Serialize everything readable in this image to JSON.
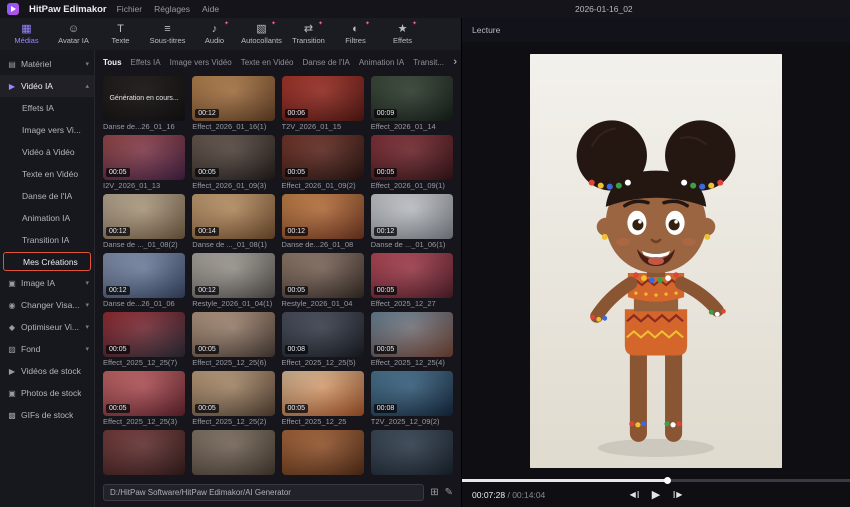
{
  "colors": {
    "accent": "#9a86ff",
    "selection_border": "#e0523a",
    "badge": "#ff5a8a",
    "progress_played": "#e8e8ec"
  },
  "menubar": {
    "app_name": "HitPaw Edimakor",
    "menus": [
      {
        "label": "Fichier"
      },
      {
        "label": "Réglages"
      },
      {
        "label": "Aide"
      }
    ],
    "document_title": "2026-01-16_02"
  },
  "toolbar": {
    "items": [
      {
        "label": "Médias",
        "icon": "▦",
        "icon_name": "media-icon",
        "active": true
      },
      {
        "label": "Avatar IA",
        "icon": "☺",
        "icon_name": "ai-avatar-icon"
      },
      {
        "label": "Texte",
        "icon": "T",
        "icon_name": "text-icon"
      },
      {
        "label": "Sous-titres",
        "icon": "≡",
        "icon_name": "subtitles-icon"
      },
      {
        "label": "Audio",
        "icon": "♪",
        "icon_name": "audio-icon",
        "badge": "✦"
      },
      {
        "label": "Autocollants",
        "icon": "▧",
        "icon_name": "stickers-icon",
        "badge": "✦"
      },
      {
        "label": "Transition",
        "icon": "⇄",
        "icon_name": "transition-icon",
        "badge": "✦"
      },
      {
        "label": "Filtres",
        "icon": "◐",
        "icon_name": "filters-icon",
        "badge": "✦"
      },
      {
        "label": "Effets",
        "icon": "★",
        "icon_name": "effects-icon",
        "badge": "✦"
      }
    ]
  },
  "sidebar": {
    "items": [
      {
        "label": "Matériel",
        "icon": "▤",
        "icon_name": "material-icon",
        "chevron": "▾"
      },
      {
        "label": "Vidéo IA",
        "icon": "▶",
        "icon_name": "ai-video-icon",
        "chevron": "▴",
        "active": true
      },
      {
        "label": "Effets IA",
        "sub": true
      },
      {
        "label": "Image vers Vi...",
        "sub": true
      },
      {
        "label": "Vidéo à Vidéo",
        "sub": true
      },
      {
        "label": "Texte en Vidéo",
        "sub": true
      },
      {
        "label": "Danse de l'IA",
        "sub": true
      },
      {
        "label": "Animation IA",
        "sub": true
      },
      {
        "label": "Transition IA",
        "sub": true
      },
      {
        "label": "Mes Créations",
        "sub": true,
        "selected": true
      },
      {
        "label": "Image IA",
        "icon": "▣",
        "icon_name": "ai-image-icon",
        "chevron": "▾"
      },
      {
        "label": "Changer Visa...",
        "icon": "◉",
        "icon_name": "face-swap-icon",
        "chevron": "▾"
      },
      {
        "label": "Optimiseur Vi...",
        "icon": "◆",
        "icon_name": "video-enhancer-icon",
        "chevron": "▾"
      },
      {
        "label": "Fond",
        "icon": "▨",
        "icon_name": "background-icon",
        "chevron": "▾"
      },
      {
        "label": "Vidéos de stock",
        "icon": "▶",
        "icon_name": "stock-videos-icon"
      },
      {
        "label": "Photos de stock",
        "icon": "▣",
        "icon_name": "stock-photos-icon"
      },
      {
        "label": "GIFs de stock",
        "icon": "▩",
        "icon_name": "stock-gifs-icon"
      }
    ]
  },
  "library": {
    "tabs": [
      {
        "label": "Tous",
        "active": true
      },
      {
        "label": "Effets IA"
      },
      {
        "label": "Image vers Vidéo"
      },
      {
        "label": "Texte en Vidéo"
      },
      {
        "label": "Danse de l'IA"
      },
      {
        "label": "Animation IA"
      },
      {
        "label": "Transit..."
      }
    ],
    "scroll_arrow": "›",
    "items": [
      {
        "label": "Danse de...26_01_16",
        "duration": "",
        "overlay": "Génération en cours...",
        "c1": "#3a3028",
        "c2": "#1e1a16"
      },
      {
        "label": "Effect_2026_01_16(1)",
        "duration": "00:12",
        "c1": "#c08850",
        "c2": "#6a4426"
      },
      {
        "label": "T2V_2026_01_15",
        "duration": "00:06",
        "c1": "#b03428",
        "c2": "#5a1812"
      },
      {
        "label": "Effect_2026_01_14",
        "duration": "00:09",
        "c1": "#3a4a38",
        "c2": "#16201a"
      },
      {
        "label": "I2V_2026_01_13",
        "duration": "00:05",
        "c1": "#a04848",
        "c2": "#4a2248"
      },
      {
        "label": "Effect_2026_01_09(3)",
        "duration": "00:05",
        "c1": "#6a5a4e",
        "c2": "#241e1c"
      },
      {
        "label": "Effect_2026_01_09(2)",
        "duration": "00:05",
        "c1": "#7a3428",
        "c2": "#2a1410"
      },
      {
        "label": "Effect_2026_01_09(1)",
        "duration": "00:05",
        "c1": "#8a3038",
        "c2": "#3a1418"
      },
      {
        "label": "Danse de ..._01_08(2)",
        "duration": "00:12",
        "c1": "#c4b49a",
        "c2": "#7a6248"
      },
      {
        "label": "Danse de ..._01_08(1)",
        "duration": "00:14",
        "c1": "#d0a878",
        "c2": "#7a5230"
      },
      {
        "label": "Danse de...26_01_08",
        "duration": "00:12",
        "c1": "#d08848",
        "c2": "#7a3a22"
      },
      {
        "label": "Danse de ..._01_06(1)",
        "duration": "00:12",
        "c1": "#d4d6da",
        "c2": "#8a9098"
      },
      {
        "label": "Danse de...26_01_06",
        "duration": "00:12",
        "c1": "#8a9ab8",
        "c2": "#3a4a6a"
      },
      {
        "label": "Restyle_2026_01_04(1)",
        "duration": "00:12",
        "c1": "#b8b2aa",
        "c2": "#5a5652"
      },
      {
        "label": "Restyle_2026_01_04",
        "duration": "00:05",
        "c1": "#9a8070",
        "c2": "#3a2e28"
      },
      {
        "label": "Effect_2025_12_27",
        "duration": "00:05",
        "c1": "#c04858",
        "c2": "#58202c"
      },
      {
        "label": "Effect_2025_12_25(7)",
        "duration": "00:05",
        "c1": "#a02830",
        "c2": "#2e2e3a"
      },
      {
        "label": "Effect_2025_12_25(6)",
        "duration": "00:05",
        "c1": "#c0a088",
        "c2": "#4e4038"
      },
      {
        "label": "Effect_2025_12_25(5)",
        "duration": "00:08",
        "c1": "#4a5060",
        "c2": "#1a1e26"
      },
      {
        "label": "Effect_2025_12_25(4)",
        "duration": "00:05",
        "c1": "#6a8aa0",
        "c2": "#7a4838"
      },
      {
        "label": "Effect_2025_12_25(3)",
        "duration": "00:05",
        "c1": "#d06868",
        "c2": "#6a2430"
      },
      {
        "label": "Effect_2025_12_25(2)",
        "duration": "00:05",
        "c1": "#caa882",
        "c2": "#5a4636"
      },
      {
        "label": "Effect_2025_12_25",
        "duration": "00:05",
        "c1": "#e8c8a0",
        "c2": "#b05828"
      },
      {
        "label": "T2V_2025_12_09(2)",
        "duration": "00:08",
        "c1": "#4a7a9a",
        "c2": "#142a42"
      },
      {
        "label": "",
        "duration": "",
        "c1": "#7a3a3a",
        "c2": "#3a1e1e"
      },
      {
        "label": "",
        "duration": "",
        "c1": "#8a7a6a",
        "c2": "#4a3e34"
      },
      {
        "label": "",
        "duration": "",
        "c1": "#b06838",
        "c2": "#5a3018"
      },
      {
        "label": "",
        "duration": "",
        "c1": "#3a4a5a",
        "c2": "#1a2430"
      }
    ],
    "path_bar": {
      "value": "D:/HitPaw Software/HitPaw Edimakor/AI Generator",
      "import_glyph": "⊞",
      "edit_glyph": "✎"
    }
  },
  "player": {
    "header": "Lecture",
    "current_time": "00:07:28",
    "separator": " / ",
    "total_time": "00:14:04",
    "progress_percent": 53,
    "controls": {
      "prev": "◀",
      "play": "▶",
      "next": "▶"
    }
  }
}
